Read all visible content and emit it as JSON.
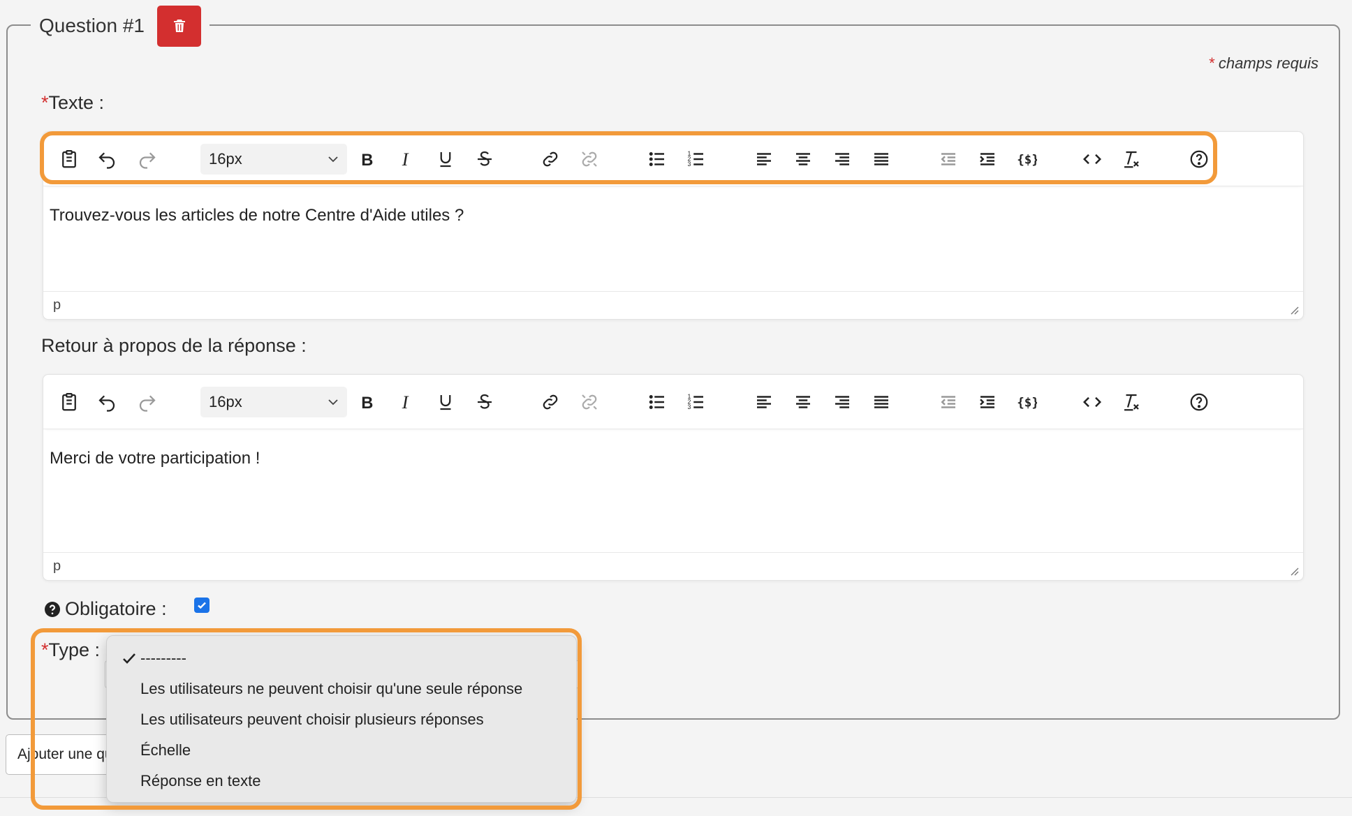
{
  "question": {
    "title": "Question #1",
    "delete_icon": "trash-icon",
    "required_marker": "*",
    "required_note": "champs requis"
  },
  "texte": {
    "label": "Texte :",
    "font_size": "16px",
    "content": "Trouvez-vous les articles de notre Centre d'Aide utiles ?",
    "status": "p"
  },
  "retour": {
    "label": "Retour à propos de la réponse :",
    "font_size": "16px",
    "content": "Merci de votre participation !",
    "status": "p"
  },
  "toolbar_icons": [
    "paste-icon",
    "undo-icon",
    "redo-icon",
    "bold-icon",
    "italic-icon",
    "underline-icon",
    "strikethrough-icon",
    "link-icon",
    "unlink-icon",
    "bullet-list-icon",
    "numbered-list-icon",
    "align-left-icon",
    "align-center-icon",
    "align-right-icon",
    "align-justify-icon",
    "outdent-icon",
    "indent-icon",
    "template-variable-icon",
    "source-code-icon",
    "clear-formatting-icon",
    "help-icon"
  ],
  "obligatoire": {
    "label": "Obligatoire :",
    "checked": true
  },
  "type": {
    "label": "Type :",
    "options": [
      {
        "label": "---------",
        "selected": true
      },
      {
        "label": "Les utilisateurs ne peuvent choisir qu'une seule réponse",
        "selected": false
      },
      {
        "label": "Les utilisateurs peuvent choisir plusieurs réponses",
        "selected": false
      },
      {
        "label": "Échelle",
        "selected": false
      },
      {
        "label": "Réponse en texte",
        "selected": false
      }
    ]
  },
  "add_button": {
    "label": "Ajouter une question"
  },
  "colors": {
    "highlight": "#f29a3a",
    "danger": "#d32f2f",
    "checkbox": "#1a73e8"
  }
}
